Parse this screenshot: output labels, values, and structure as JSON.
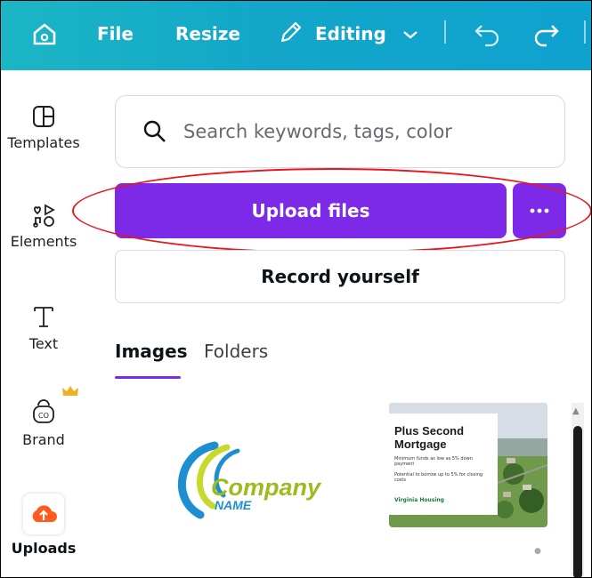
{
  "topbar": {
    "file_label": "File",
    "resize_label": "Resize",
    "editing_label": "Editing",
    "home_icon": "home-icon",
    "undo_icon": "undo-icon",
    "redo_icon": "redo-icon",
    "gradient": [
      "#1bb6c5",
      "#0fa2cf"
    ]
  },
  "sidebar": {
    "items": [
      {
        "label": "Templates",
        "icon": "templates-icon"
      },
      {
        "label": "Elements",
        "icon": "elements-icon"
      },
      {
        "label": "Text",
        "icon": "text-icon"
      },
      {
        "label": "Brand",
        "icon": "brand-icon"
      },
      {
        "label": "Uploads",
        "icon": "upload-cloud-icon"
      }
    ]
  },
  "search": {
    "placeholder": "Search keywords, tags, color"
  },
  "actions": {
    "upload_label": "Upload files",
    "record_label": "Record yourself",
    "accent": "#7d2ae8"
  },
  "tabs": [
    {
      "label": "Images",
      "active": true
    },
    {
      "label": "Folders",
      "active": false
    }
  ],
  "uploads": [
    {
      "logo_text": "Company",
      "logo_sub": "NAME"
    },
    {
      "title": "Plus Second Mortgage",
      "bullets": [
        "Minimum funds as low as 5% down payment",
        "Potential to borrow up to 5% for closing costs"
      ],
      "brand": "Virginia Housing"
    }
  ]
}
